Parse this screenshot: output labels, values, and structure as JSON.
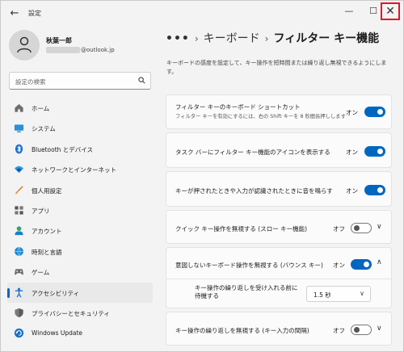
{
  "window": {
    "title": "設定",
    "back_glyph": "←",
    "min_glyph": "—",
    "max_glyph": "☐",
    "close_glyph": "✕"
  },
  "profile": {
    "name": "秋葉一郎",
    "email_suffix": "@outlook.jp"
  },
  "search": {
    "placeholder": "設定の検索",
    "icon": "search-icon"
  },
  "nav": {
    "items": [
      {
        "label": "ホーム",
        "icon": "home-icon"
      },
      {
        "label": "システム",
        "icon": "system-icon"
      },
      {
        "label": "Bluetooth とデバイス",
        "icon": "bluetooth-icon"
      },
      {
        "label": "ネットワークとインターネット",
        "icon": "wifi-icon"
      },
      {
        "label": "個人用設定",
        "icon": "brush-icon"
      },
      {
        "label": "アプリ",
        "icon": "apps-icon"
      },
      {
        "label": "アカウント",
        "icon": "account-icon"
      },
      {
        "label": "時刻と言語",
        "icon": "globe-clock-icon"
      },
      {
        "label": "ゲーム",
        "icon": "gamepad-icon"
      },
      {
        "label": "アクセシビリティ",
        "icon": "accessibility-icon",
        "active": true
      },
      {
        "label": "プライバシーとセキュリティ",
        "icon": "shield-icon"
      },
      {
        "label": "Windows Update",
        "icon": "update-icon"
      }
    ]
  },
  "breadcrumb": {
    "dots": "•••",
    "sep": "›",
    "parent": "キーボード",
    "current": "フィルター キー機能"
  },
  "description": "キーボードの感度を設定して、キー操作を短時間または繰り返し無視できるようにします。",
  "settings": [
    {
      "title": "フィルター キーのキーボード ショートカット",
      "subtitle": "フィルター キーを有効にするには、右の Shift キーを 8 秒間長押しします",
      "state": "オン",
      "on": true
    },
    {
      "title": "タスク バーにフィルター キー機能のアイコンを表示する",
      "state": "オン",
      "on": true
    },
    {
      "title": "キーが押されたときや入力が認識されたときに音を鳴らす",
      "state": "オン",
      "on": true
    },
    {
      "title": "クイック キー操作を無視する (スロー キー機能)",
      "state": "オフ",
      "on": false,
      "chevron": "∨"
    },
    {
      "title": "意図しないキーボード操作を無視する (バウンス キー)",
      "state": "オン",
      "on": true,
      "chevron": "∧"
    },
    {
      "title": "キー操作の繰り返しを無視する (キー入力の間隔)",
      "state": "オフ",
      "on": false,
      "chevron": "∨"
    }
  ],
  "bounce_sub": {
    "label": "キー操作の繰り返しを受け入れる前に待機する",
    "value": "1.5 秒",
    "chevron": "∨"
  },
  "colors": {
    "accent": "#0067c0",
    "close_highlight": "#e81123"
  }
}
